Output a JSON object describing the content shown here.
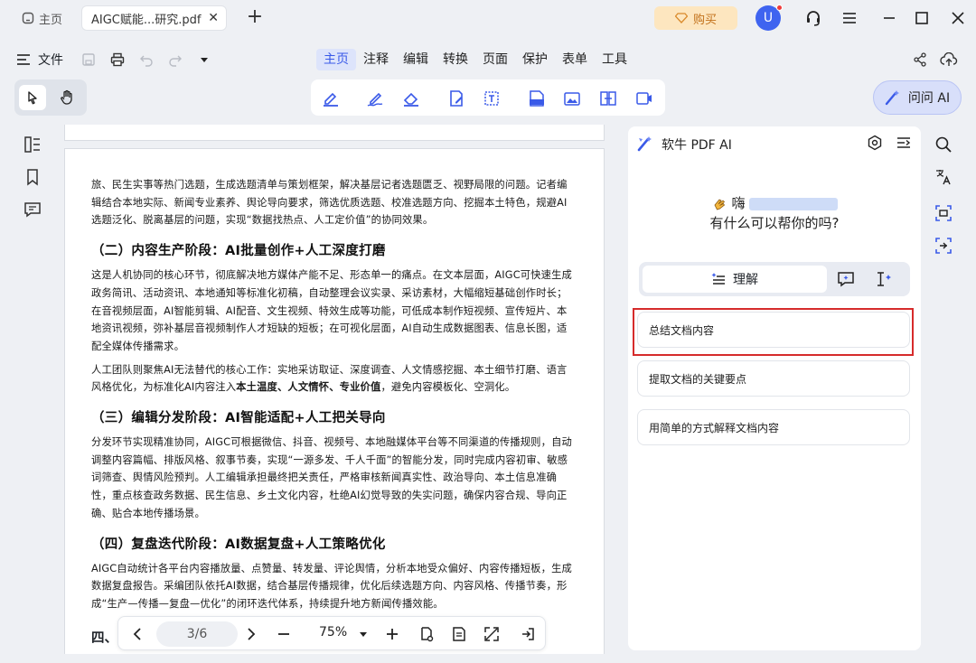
{
  "tabs": {
    "home_label": "主页",
    "doc_label": "AIGC赋能...研究.pdf",
    "close_glyph": "✕",
    "add_glyph": "+"
  },
  "header": {
    "buy_label": "购买",
    "avatar_letter": "U"
  },
  "menubar": {
    "file_label": "文件",
    "tabs": [
      "主页",
      "注释",
      "编辑",
      "转换",
      "页面",
      "保护",
      "表单",
      "工具"
    ],
    "active_tab": "主页"
  },
  "toolbar": {
    "ask_ai_label": "问问 AI"
  },
  "document": {
    "p1": "旅、民生实事等热门选题，生成选题清单与策划框架，解决基层记者选题匮乏、视野局限的问题。记者编辑结合本地实际、新闻专业素养、舆论导向要求，筛选优质选题、校准选题方向、挖掘本土特色，规避AI选题泛化、脱离基层的问题，实现“数据找热点、人工定价值”的协同效果。",
    "h2": "（二）内容生产阶段：AI批量创作+人工深度打磨",
    "p2": "这是人机协同的核心环节，彻底解决地方媒体产能不足、形态单一的痛点。在文本层面，AIGC可快速生成政务简讯、活动资讯、本地通知等标准化初稿，自动整理会议实录、采访素材，大幅缩短基础创作时长；在音视频层面，AI智能剪辑、AI配音、文生视频、特效生成等功能，可低成本制作短视频、宣传短片、本地资讯视频，弥补基层音视频制作人才短缺的短板；在可视化层面，AI自动生成数据图表、信息长图，适配全媒体传播需求。",
    "p3_pre": "人工团队则聚焦AI无法替代的核心工作：实地采访取证、深度调查、人文情感挖掘、本土细节打磨、语言风格优化，为标准化AI内容注入",
    "p3_bold": "本土温度、人文情怀、专业价值",
    "p3_post": "，避免内容模板化、空洞化。",
    "h3": "（三）编辑分发阶段：AI智能适配+人工把关导向",
    "p4": "分发环节实现精准协同，AIGC可根据微信、抖音、视频号、本地融媒体平台等不同渠道的传播规则，自动调整内容篇幅、排版风格、叙事节奏，实现“一源多发、千人千面”的智能分发，同时完成内容初审、敏感词筛查、舆情风险预判。人工编辑承担最终把关责任，严格审核新闻真实性、政治导向、本土信息准确性，重点核查政务数据、民生信息、乡土文化内容，杜绝AI幻觉导致的失实问题，确保内容合规、导向正确、贴合本地传播场景。",
    "h4": "（四）复盘迭代阶段：AI数据复盘+人工策略优化",
    "p5": "AIGC自动统计各平台内容播放量、点赞量、转发量、评论舆情，分析本地受众偏好、内容传播短板，生成数据复盘报告。采编团队依托AI数据，结合基层传播规律，优化后续选题方向、内容风格、传播节奏，形成“生产—传播—复盘—优化”的闭环迭代体系，持续提升地方新闻传播效能。",
    "h5_partial": "四、"
  },
  "navbar": {
    "page_value": "3/6",
    "zoom_value": "75%"
  },
  "ai_panel": {
    "title": "软牛 PDF AI",
    "greeting_hi": "嗨",
    "greeting_question": "有什么可以帮你的吗?",
    "mode_label": "理解",
    "suggestions": [
      "总结文档内容",
      "提取文档的关键要点",
      "用简单的方式解释文档内容"
    ]
  },
  "colors": {
    "accent": "#3a5ae8",
    "buy_bg": "#fde6bf",
    "highlight_border": "#d62b2b"
  }
}
